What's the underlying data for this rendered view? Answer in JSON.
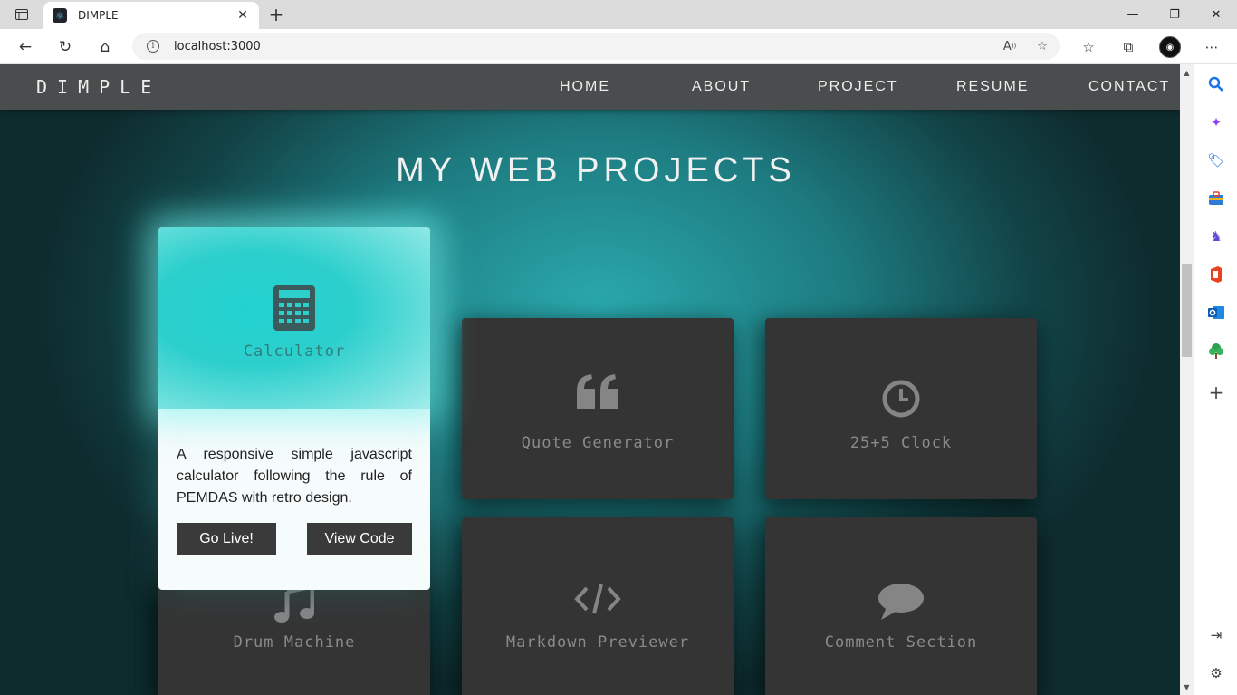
{
  "browser": {
    "tab_title": "DIMPLE",
    "tab_icon": "react-favicon-icon",
    "url": "localhost:3000"
  },
  "site": {
    "brand": "DIMPLE",
    "nav": [
      "HOME",
      "ABOUT",
      "PROJECT",
      "RESUME",
      "CONTACT"
    ],
    "heading": "MY WEB PROJECTS"
  },
  "projects": [
    {
      "title": "Calculator",
      "icon": "calculator-icon",
      "description": "A responsive simple javascript calculator following the rule of PEMDAS with retro design.",
      "live_label": "Go Live!",
      "code_label": "View Code"
    },
    {
      "title": "Quote Generator",
      "icon": "quote-icon"
    },
    {
      "title": "25+5 Clock",
      "icon": "clock-icon"
    },
    {
      "title": "Drum Machine",
      "icon": "music-icon"
    },
    {
      "title": "Markdown Previewer",
      "icon": "code-icon"
    },
    {
      "title": "Comment Section",
      "icon": "comment-icon"
    }
  ],
  "colors": {
    "navbar": "#4a4d4d",
    "card": "#343434",
    "accent": "#2ccfcc",
    "button": "#3a3a3a"
  }
}
